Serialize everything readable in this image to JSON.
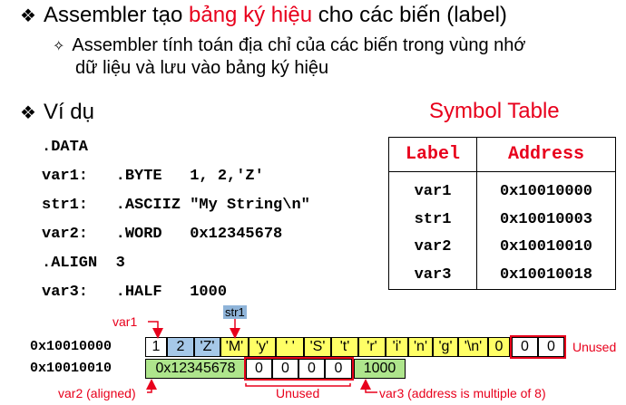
{
  "bullets": {
    "b1_before": "Assembler tạo ",
    "b1_highlight": "bảng ký hiệu",
    "b1_after": " cho các biến (label)",
    "b2_line1": "Assembler tính toán địa chỉ của các biến trong vùng nhớ",
    "b2_line2": "dữ liệu và lưu vào bảng ký hiệu",
    "b3": "Ví dụ"
  },
  "code": [
    ".DATA",
    "var1:   .BYTE   1, 2,'Z'",
    "str1:   .ASCIIZ \"My String\\n\"",
    "var2:   .WORD   0x12345678",
    ".ALIGN  3",
    "var3:   .HALF   1000"
  ],
  "symbol_table": {
    "title": "Symbol Table",
    "headers": [
      "Label",
      "Address"
    ],
    "rows": [
      [
        "var1",
        "0x10010000"
      ],
      [
        "str1",
        "0x10010003"
      ],
      [
        "var2",
        "0x10010010"
      ],
      [
        "var3",
        "0x10010018"
      ]
    ]
  },
  "memory": {
    "row1_address": "0x10010000",
    "row2_address": "0x10010010",
    "row1_cells": [
      "1",
      "2",
      "'Z'",
      "'M'",
      "'y'",
      "' '",
      "'S'",
      "'t'",
      "'r'",
      "'i'",
      "'n'",
      "'g'",
      "'\\n'",
      "0",
      "0",
      "0"
    ],
    "row2_cells": [
      "0x12345678",
      "0",
      "0",
      "0",
      "0",
      "1000"
    ],
    "labels": {
      "var1": "var1",
      "str1": "str1",
      "unused_right": "Unused",
      "var2": "var2 (aligned)",
      "unused_bottom": "Unused",
      "var3": "var3 (address is multiple of 8)"
    }
  },
  "colors": {
    "accent": "#e8001c",
    "ascii": "#ffff66",
    "bytes": "#a6c8e8",
    "word": "#aee58c"
  }
}
